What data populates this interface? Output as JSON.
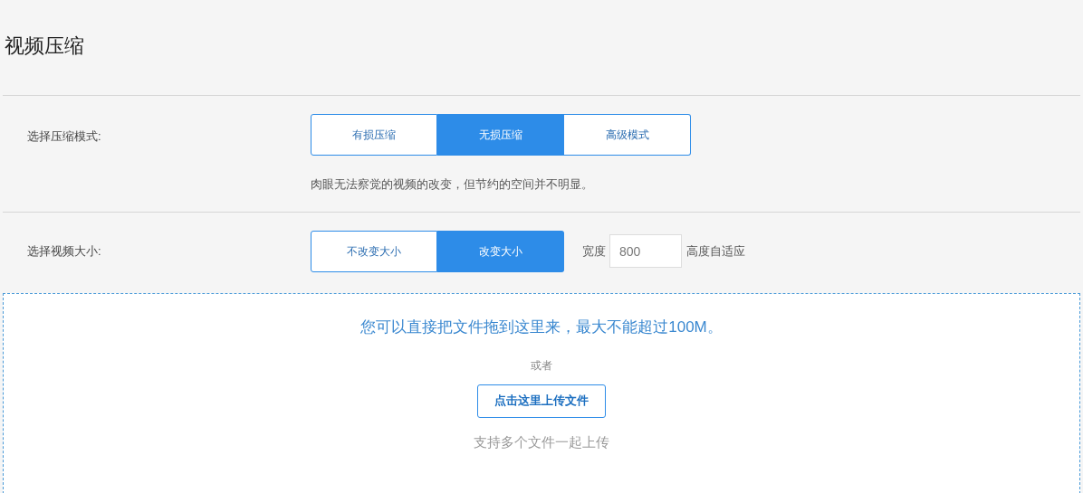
{
  "title": "视频压缩",
  "compression": {
    "label": "选择压缩模式:",
    "options": [
      {
        "label": "有损压缩",
        "selected": false
      },
      {
        "label": "无损压缩",
        "selected": true
      },
      {
        "label": "高级模式",
        "selected": false
      }
    ],
    "hint": "肉眼无法察觉的视频的改变，但节约的空间并不明显。"
  },
  "size": {
    "label": "选择视频大小:",
    "options": [
      {
        "label": "不改变大小",
        "selected": false
      },
      {
        "label": "改变大小",
        "selected": true
      }
    ],
    "width_label": "宽度",
    "width_value": "800",
    "height_label": "高度自适应"
  },
  "upload": {
    "drop_text": "您可以直接把文件拖到这里来，最大不能超过100M。",
    "or": "或者",
    "button": "点击这里上传文件",
    "note": "支持多个文件一起上传"
  }
}
